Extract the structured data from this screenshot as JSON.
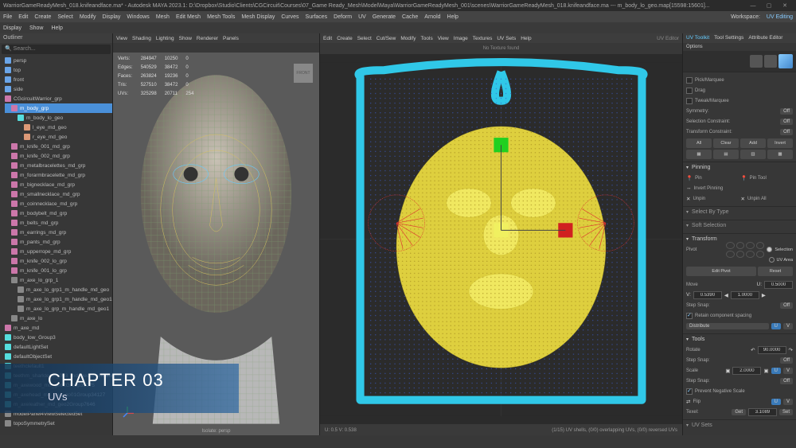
{
  "titlebar": {
    "text": "WarriorGameReadyMesh_018.knifeandface.ma* - Autodesk MAYA 2023.1: D:\\Dropbox\\Studio\\Clients\\CGCircuit\\Courses\\07_Game Ready_Mesh\\Model\\Maya\\WarriorGameReadyMesh_001\\scenes\\WarriorGameReadyMesh_018.knifeandface.ma  ---  m_body_lo_geo.map[15598:15601]..."
  },
  "menubar": [
    "File",
    "Edit",
    "Create",
    "Select",
    "Modify",
    "Display",
    "Windows",
    "Mesh",
    "Edit Mesh",
    "Mesh Tools",
    "Mesh Display",
    "Curves",
    "Surfaces",
    "Deform",
    "UV",
    "Generate",
    "Cache",
    "Arnold",
    "Help"
  ],
  "toolbar": [
    "Display",
    "Show",
    "Help"
  ],
  "outliner": {
    "head": "Outliner",
    "search": "Search...",
    "items": [
      {
        "indent": 0,
        "ico": "blue",
        "label": "persp"
      },
      {
        "indent": 0,
        "ico": "blue",
        "label": "top"
      },
      {
        "indent": 0,
        "ico": "blue",
        "label": "front"
      },
      {
        "indent": 0,
        "ico": "blue",
        "label": "side"
      },
      {
        "indent": 0,
        "ico": "pink",
        "label": "CGcircuitWarrior_grp"
      },
      {
        "indent": 1,
        "ico": "pink",
        "label": "m_body_grp",
        "selected": true
      },
      {
        "indent": 2,
        "ico": "cyan",
        "label": "m_body_lo_geo"
      },
      {
        "indent": 3,
        "ico": "orange",
        "label": "l_eye_md_geo"
      },
      {
        "indent": 3,
        "ico": "orange",
        "label": "r_eye_md_geo"
      },
      {
        "indent": 1,
        "ico": "pink",
        "label": "m_knife_001_md_grp"
      },
      {
        "indent": 1,
        "ico": "pink",
        "label": "m_knife_002_md_grp"
      },
      {
        "indent": 1,
        "ico": "pink",
        "label": "m_metalbracelettes_md_grp"
      },
      {
        "indent": 1,
        "ico": "pink",
        "label": "m_forarmbracelette_md_grp"
      },
      {
        "indent": 1,
        "ico": "pink",
        "label": "m_bignecklace_md_grp"
      },
      {
        "indent": 1,
        "ico": "pink",
        "label": "m_smallnecklace_md_grp"
      },
      {
        "indent": 1,
        "ico": "pink",
        "label": "m_coinnecklace_md_grp"
      },
      {
        "indent": 1,
        "ico": "pink",
        "label": "m_bodybelt_md_grp"
      },
      {
        "indent": 1,
        "ico": "pink",
        "label": "m_belts_md_grp"
      },
      {
        "indent": 1,
        "ico": "pink",
        "label": "m_earrings_md_grp"
      },
      {
        "indent": 1,
        "ico": "pink",
        "label": "m_pants_md_grp"
      },
      {
        "indent": 1,
        "ico": "pink",
        "label": "m_upperrope_md_grp"
      },
      {
        "indent": 1,
        "ico": "pink",
        "label": "m_knife_002_lo_grp"
      },
      {
        "indent": 1,
        "ico": "pink",
        "label": "m_knife_001_lo_grp"
      },
      {
        "indent": 1,
        "ico": "gray",
        "label": "m_axe_lo_grp_1"
      },
      {
        "indent": 2,
        "ico": "gray",
        "label": "m_axe_lo_grp1_m_handle_md_geo"
      },
      {
        "indent": 2,
        "ico": "gray",
        "label": "m_axe_lo_grp1_m_handle_md_geo1"
      },
      {
        "indent": 2,
        "ico": "gray",
        "label": "m_axe_lo_grp_m_handle_md_geo1"
      },
      {
        "indent": 1,
        "ico": "gray",
        "label": "m_axe_lo"
      },
      {
        "indent": 0,
        "ico": "pink",
        "label": "m_axe_md"
      },
      {
        "indent": 0,
        "ico": "cyan",
        "label": "body_low_Group3"
      },
      {
        "indent": 0,
        "ico": "cyan",
        "label": "defaultLightSet"
      },
      {
        "indent": 0,
        "ico": "cyan",
        "label": "defaultObjectSet"
      },
      {
        "indent": 0,
        "ico": "cyan",
        "label": "teethclefault1"
      },
      {
        "indent": 0,
        "ico": "cyan",
        "label": "teethm_sharkteeth_003_md_geom_smallneckles…"
      },
      {
        "indent": 0,
        "ico": "cyan",
        "label": "m_axewood_md_geo2Group35075"
      },
      {
        "indent": 0,
        "ico": "cyan",
        "label": "m_axehead_md_geo_oo01Group34127"
      },
      {
        "indent": 0,
        "ico": "cyan",
        "label": "m_axeleather_md_geo2Group7646"
      },
      {
        "indent": 0,
        "ico": "gray",
        "label": "modelPanel4ViewSelected5et"
      },
      {
        "indent": 0,
        "ico": "gray",
        "label": "topoSymmetrySet"
      }
    ]
  },
  "viewport": {
    "menu": [
      "View",
      "Shading",
      "Lighting",
      "Show",
      "Renderer",
      "Panels"
    ],
    "stats": [
      {
        "k": "Verts:",
        "a": "284947",
        "b": "10250",
        "c": "0"
      },
      {
        "k": "Edges:",
        "a": "540529",
        "b": "38472",
        "c": "0"
      },
      {
        "k": "Faces:",
        "a": "263824",
        "b": "19236",
        "c": "0"
      },
      {
        "k": "Tris:",
        "a": "527510",
        "b": "38472",
        "c": "0"
      },
      {
        "k": "UVs:",
        "a": "325298",
        "b": "20711",
        "c": "254"
      }
    ],
    "camlabel": "FRONT",
    "isolate": "Isolate: persp"
  },
  "uvedit": {
    "title": "UV Editor",
    "menu": [
      "Edit",
      "Create",
      "Select",
      "Cut/Sew",
      "Modify",
      "Tools",
      "View",
      "Image",
      "Textures",
      "UV Sets",
      "Help"
    ],
    "notexture": "No Texture found",
    "coords": "U: 0.5 V: 0.538",
    "status": "(1/15) UV shells, (0/0) overlapping UVs, (0/0) reversed UVs"
  },
  "rightpanel": {
    "tabs": [
      "UV Toolkit",
      "Tool Settings",
      "Attribute Editor"
    ],
    "options": "Options",
    "sel": {
      "pick": "Pick/Marquee",
      "drag": "Drag",
      "tweak": "Tweak/Marquee"
    },
    "symmetry": {
      "label": "Symmetry:",
      "val": "Off"
    },
    "selcon": {
      "label": "Selection Constraint:",
      "val": "Off"
    },
    "transcon": {
      "label": "Transform Constraint:",
      "val": "Off"
    },
    "btns4": [
      "All",
      "Clear",
      "Add",
      "Invert"
    ],
    "pinning": {
      "title": "Pinning",
      "pin": "Pin",
      "pintool": "Pin Tool",
      "invert": "Invert Pinning",
      "unpin": "Unpin",
      "unpinall": "Unpin All"
    },
    "selby": "Select By Type",
    "softsel": "Soft Selection",
    "transform": {
      "title": "Transform",
      "pivot": "Pivot",
      "selection": "Selection",
      "uvarea": "UV Area",
      "editpivot": "Edit Pivot",
      "reset": "Reset",
      "move": "Move",
      "moveU": "0.5000",
      "moveV": "0.5390",
      "moveStep": "1.0000",
      "stepsnap": "Step Snap:",
      "off": "Off",
      "retain": "Retain component spacing",
      "distribute": "Distribute",
      "u": "U",
      "v": "V"
    },
    "tools": {
      "title": "Tools",
      "rotate": "Rotate",
      "rotval": "90.0000",
      "scale": "Scale",
      "scaleval": "2.0000",
      "prevent": "Prevent Negative Scale",
      "flip": "Flip",
      "texel": "Texel:",
      "get": "Get",
      "texelval": "3.1089",
      "set": "Set"
    },
    "uvsets": "UV Sets"
  },
  "workspace": {
    "label": "Workspace:",
    "val": "UV Editing"
  },
  "chapter": {
    "title": "CHAPTER 03",
    "sub": "UVs"
  }
}
